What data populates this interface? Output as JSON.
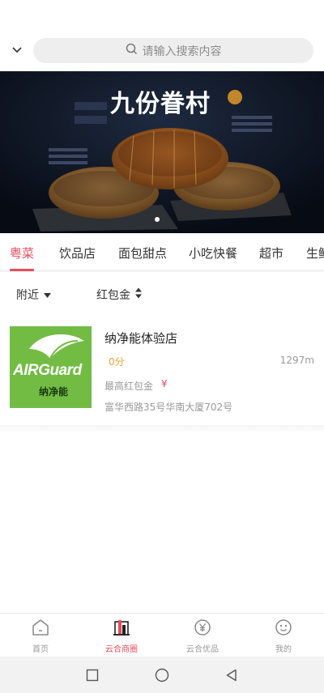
{
  "search": {
    "placeholder": "请输入搜索内容"
  },
  "banner": {
    "title": "九份眷村"
  },
  "categories": [
    "粤菜",
    "饮品店",
    "面包甜点",
    "小吃快餐",
    "超市",
    "生鲜"
  ],
  "filters": {
    "nearby": "附近",
    "red_packet": "红包金"
  },
  "shop": {
    "name": "纳净能体验店",
    "score": "0分",
    "distance": "1297m",
    "max_red_packet_label": "最高红包金",
    "currency": "¥",
    "address": "富华西路35号华南大厦702号",
    "logo_text": "AIRGuard",
    "logo_subtext": "纳净能"
  },
  "nav": {
    "home": "首页",
    "merchants": "云合商圈",
    "deals": "云合优品",
    "mine": "我的"
  },
  "colors": {
    "accent": "#e94b5b",
    "score": "#e9a43b",
    "logo_green": "#72bc44"
  },
  "icons": [
    "chevron-down-icon",
    "search-icon",
    "sort-arrows-icon",
    "home-icon",
    "store-icon",
    "yuan-coin-icon",
    "smiley-icon"
  ]
}
